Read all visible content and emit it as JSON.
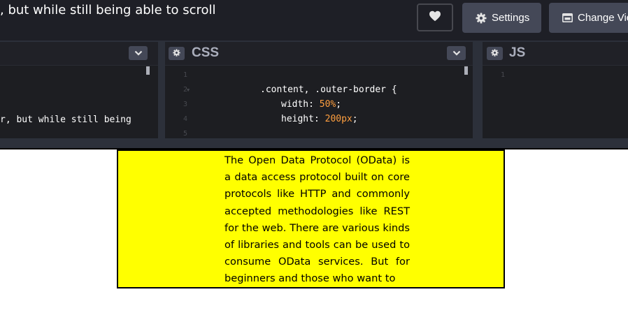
{
  "header": {
    "title": ", but while still being able to scroll",
    "buttons": {
      "settings_label": "Settings",
      "change_view_label": "Change View"
    }
  },
  "editors": {
    "left": {
      "code_fragment": "r, but while still being"
    },
    "css": {
      "name": "CSS",
      "line_numbers": [
        "1",
        "2",
        "3",
        "4",
        "5"
      ],
      "lines": {
        "selector": ".content, .outer-border {",
        "width_prop": "width: ",
        "width_val": "50%",
        "height_prop": "height: ",
        "height_val": "200px",
        "semicolon": ";"
      }
    },
    "js": {
      "name": "JS",
      "line_numbers": [
        "1"
      ]
    }
  },
  "result": {
    "paragraph": "The Open Data Protocol (OData) is a data access protocol built on core protocols like HTTP and commonly accepted methodologies like REST for the web. There are various kinds of libraries and tools can be used to consume OData services. But for beginners and those who want to"
  },
  "colors": {
    "header_bg": "#1e1f26",
    "button_bg": "#444857",
    "editor_bg": "#1d1e22",
    "number_orange": "#ff9f3f",
    "result_bg": "#ffff00"
  },
  "icons": [
    "heart-icon",
    "gear-icon",
    "change-view-icon",
    "chevron-down-icon"
  ]
}
